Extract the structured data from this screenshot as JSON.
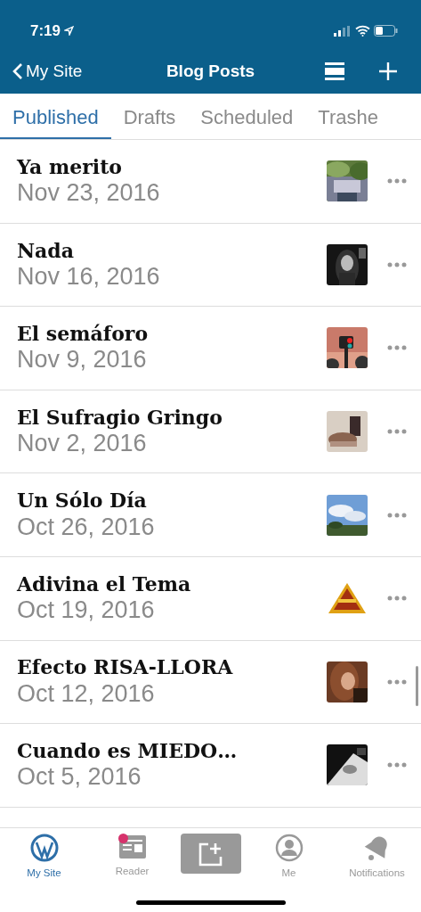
{
  "status_bar": {
    "time": "7:19"
  },
  "nav": {
    "back": "My Site",
    "title": "Blog Posts"
  },
  "tabs": [
    {
      "label": "Published",
      "selected": true
    },
    {
      "label": "Drafts",
      "selected": false
    },
    {
      "label": "Scheduled",
      "selected": false
    },
    {
      "label": "Trashe",
      "selected": false
    }
  ],
  "posts": [
    {
      "title": "Ya merito",
      "date": "Nov 23, 2016"
    },
    {
      "title": "Nada",
      "date": "Nov 16, 2016"
    },
    {
      "title": "El semáforo",
      "date": "Nov 9, 2016"
    },
    {
      "title": "El Sufragio Gringo",
      "date": "Nov 2, 2016"
    },
    {
      "title": "Un Sólo Día",
      "date": "Oct 26, 2016"
    },
    {
      "title": "Adivina el Tema",
      "date": "Oct 19, 2016"
    },
    {
      "title": "Efecto RISA-LLORA",
      "date": "Oct 12, 2016"
    },
    {
      "title": "Cuando es MIEDO…",
      "date": "Oct 5, 2016"
    }
  ],
  "tab_bar": [
    {
      "kind": "site",
      "label": "My Site",
      "selected": true
    },
    {
      "kind": "reader",
      "label": "Reader",
      "selected": false,
      "badge": true
    },
    {
      "kind": "write",
      "selected": false
    },
    {
      "kind": "me",
      "label": "Me",
      "selected": false
    },
    {
      "kind": "notifications",
      "label": "Notifications",
      "selected": false
    }
  ]
}
